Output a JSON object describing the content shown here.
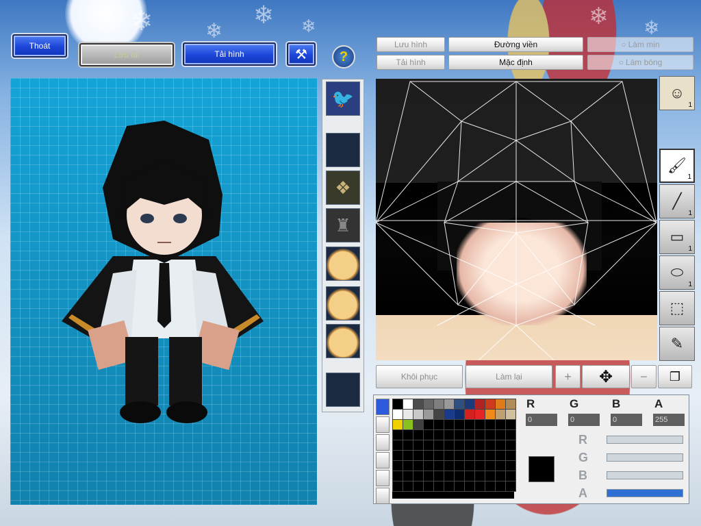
{
  "top_bar": {
    "exit_label": "Thoát",
    "save_label": "Lưu lại",
    "reload_label": "Tải hình"
  },
  "editor_toolbar": {
    "save_image_label": "Lưu hình",
    "load_image_label": "Tải hình",
    "outline_label": "Đường viền",
    "default_label": "Mặc định",
    "smooth_label": "Làm mịn",
    "shade_label": "Làm bóng"
  },
  "bottom_bar": {
    "restore_label": "Khôi phục",
    "redo_label": "Làm lại"
  },
  "tools": {
    "face_count": "1",
    "brush_count": "1",
    "line_count": "1",
    "rect_count": "1",
    "ellipse_count": "1"
  },
  "color": {
    "r_label": "R",
    "g_label": "G",
    "b_label": "B",
    "a_label": "A",
    "r_value": "0",
    "g_value": "0",
    "b_value": "0",
    "a_value": "255",
    "slider_r": 0,
    "slider_g": 0,
    "slider_b": 0,
    "slider_a": 1,
    "current": "#000000"
  },
  "palette": [
    "#000000",
    "#ffffff",
    "#4d4d4d",
    "#666666",
    "#7f7f7f",
    "#999999",
    "#2e4f7f",
    "#1c3a7a",
    "#b22222",
    "#cc3b1b",
    "#e07b1a",
    "#b08c5a",
    "#ffffff",
    "#e8e8e8",
    "#c8c8c8",
    "#9a9a9a",
    "#444444",
    "#1a3a8c",
    "#0f2d6e",
    "#d42020",
    "#e52525",
    "#f08a1a",
    "#c0a070",
    "#d0c0a0",
    "#f0d000",
    "#8ac020",
    "#404040"
  ]
}
